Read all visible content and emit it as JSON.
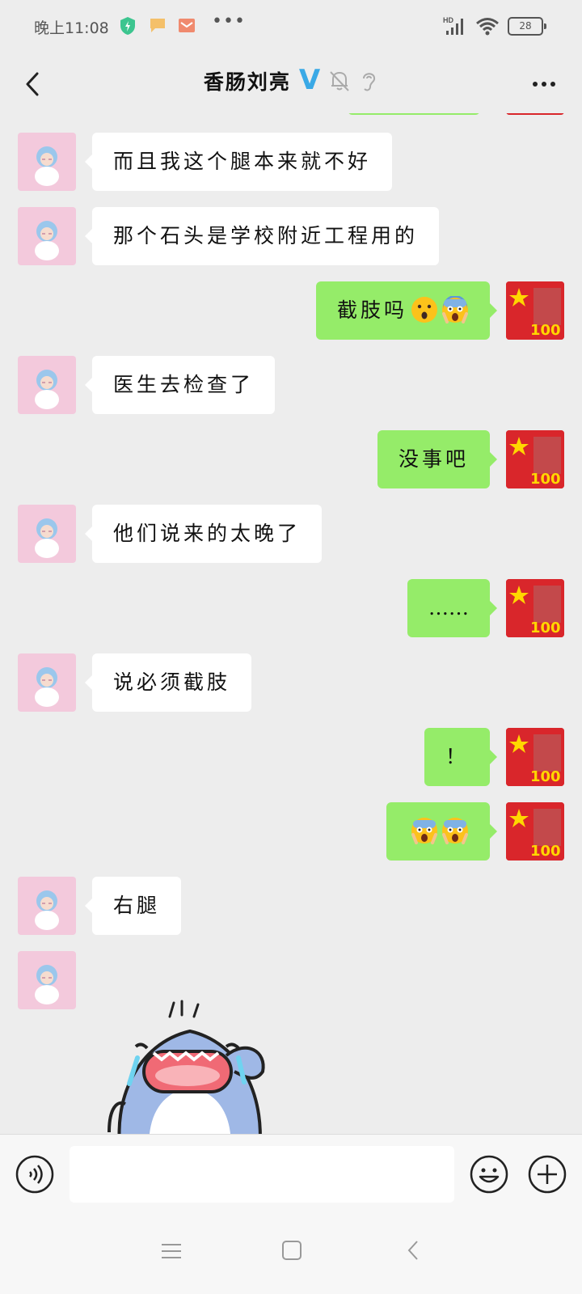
{
  "status_bar": {
    "time": "晚上11:08",
    "network": "HD",
    "battery": "28"
  },
  "header": {
    "title": "香肠刘亮",
    "badge": "V"
  },
  "messages": [
    {
      "side": "left",
      "text": "而且我这个腿本来就不好"
    },
    {
      "side": "left",
      "text": "那个石头是学校附近工程用的"
    },
    {
      "side": "right",
      "text": "截肢吗",
      "emojis": [
        "surprised-face",
        "screaming-face"
      ]
    },
    {
      "side": "left",
      "text": "医生去检查了"
    },
    {
      "side": "right",
      "text": "没事吧"
    },
    {
      "side": "left",
      "text": "他们说来的太晚了"
    },
    {
      "side": "right",
      "text": "……"
    },
    {
      "side": "left",
      "text": "说必须截肢"
    },
    {
      "side": "right",
      "text": "！"
    },
    {
      "side": "right",
      "text": "",
      "emojis": [
        "screaming-face",
        "screaming-face"
      ]
    },
    {
      "side": "left",
      "text": "右腿"
    },
    {
      "side": "left",
      "type": "sticker",
      "sticker": "crying-shark-sticker"
    }
  ],
  "input": {
    "value": "",
    "placeholder": ""
  },
  "colors": {
    "background": "#ededed",
    "bubble_self": "#95ec69",
    "bubble_other": "#ffffff",
    "badge": "#3aa9e6"
  },
  "icons": [
    "back-arrow-icon",
    "mute-bell-icon",
    "ear-icon",
    "more-icon",
    "voice-icon",
    "emoji-icon",
    "plus-icon",
    "nav-menu-icon",
    "nav-home-icon",
    "nav-back-icon"
  ]
}
